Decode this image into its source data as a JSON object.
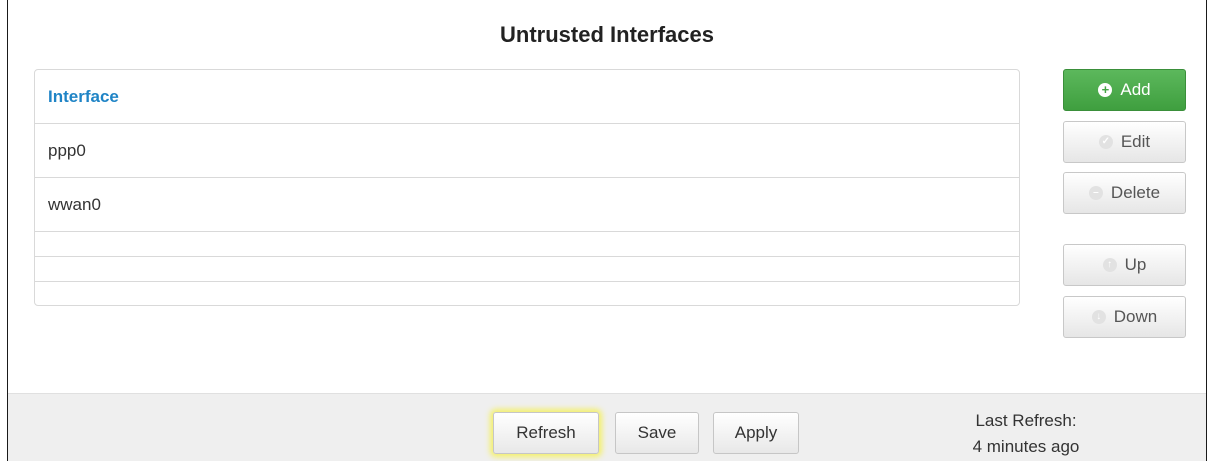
{
  "panel": {
    "title": "Untrusted Interfaces"
  },
  "table": {
    "header": "Interface",
    "rows": [
      "ppp0",
      "wwan0"
    ]
  },
  "side_buttons": {
    "add": "Add",
    "edit": "Edit",
    "delete": "Delete",
    "up": "Up",
    "down": "Down"
  },
  "footer": {
    "refresh": "Refresh",
    "save": "Save",
    "apply": "Apply",
    "last_refresh_label": "Last Refresh:",
    "last_refresh_value": "4 minutes ago"
  },
  "colors": {
    "accent": "#1f84c6",
    "add_button": "#4cae4c",
    "highlight": "#f4f06a"
  },
  "icons": {
    "add": "plus-circle-icon",
    "edit": "check-circle-icon",
    "delete": "minus-circle-icon",
    "up": "arrow-up-circle-icon",
    "down": "arrow-down-circle-icon"
  }
}
